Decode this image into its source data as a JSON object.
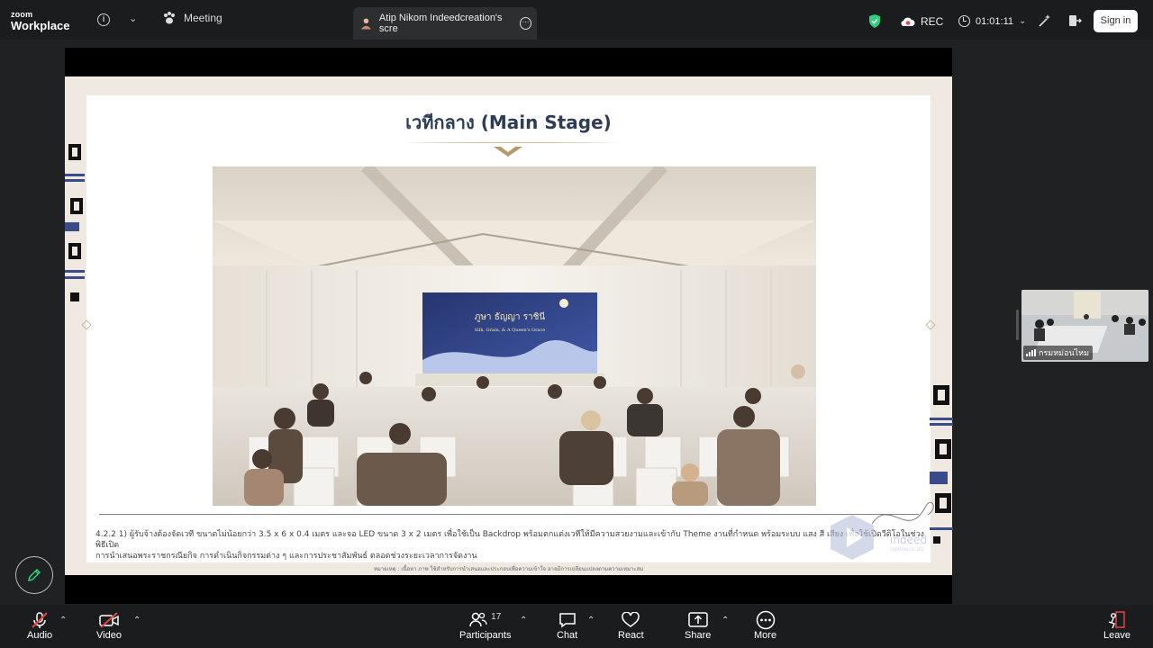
{
  "app": {
    "logo_line1": "zoom",
    "logo_line2": "Workplace"
  },
  "topbar": {
    "meeting_label": "Meeting",
    "share_tab_label": "Atip Nikom Indeedcreation's scre",
    "rec_label": "REC",
    "timer": "01:01:11",
    "sign_in_label": "Sign in"
  },
  "slide": {
    "title": "เวทีกลาง (Main Stage)",
    "backdrop_title": "ภูษา ธัญญา ราชินี",
    "backdrop_subtitle": "Silk, Grain, & A Queen's Grace",
    "caption_line1": "4.2.2 1) ผู้รับจ้างต้องจัดเวที ขนาดไม่น้อยกว่า 3.5 x 6 x 0.4 เมตร และจอ LED ขนาด 3 x 2 เมตร เพื่อใช้เป็น Backdrop พร้อมตกแต่งเวทีให้มีความสวยงามและเข้ากับ Theme งานที่กำหนด พร้อมระบบ แสง สี เสียง เพื่อใช้เปิดวีดิโอในช่วงพิธีเปิด",
    "caption_line2": "การนำเสนอพระราชกรณียกิจ การดำเนินกิจกรรมต่าง ๆ และการประชาสัมพันธ์ ตลอดช่วงระยะเวลาการจัดงาน",
    "footnote": "หมายเหตุ : เนื้อหา ภาพ ใช้สำหรับการนำเสนอและประกอบเพื่อความเข้าใจ อาจมีการเปลี่ยนแปลงตามความเหมาะสม",
    "watermark_text": "indeed",
    "watermark_sub": "CREATION CO.,LTD."
  },
  "participant_tile": {
    "name": "กรมหม่อนไหม"
  },
  "bottombar": {
    "audio": "Audio",
    "video": "Video",
    "participants": "Participants",
    "participants_count": "17",
    "chat": "Chat",
    "react": "React",
    "share": "Share",
    "more": "More",
    "leave": "Leave"
  },
  "colors": {
    "accent_green": "#2bd17e",
    "rec_red": "#e74c3c",
    "leave_red": "#e34545",
    "slide_title": "#2e3c58"
  }
}
